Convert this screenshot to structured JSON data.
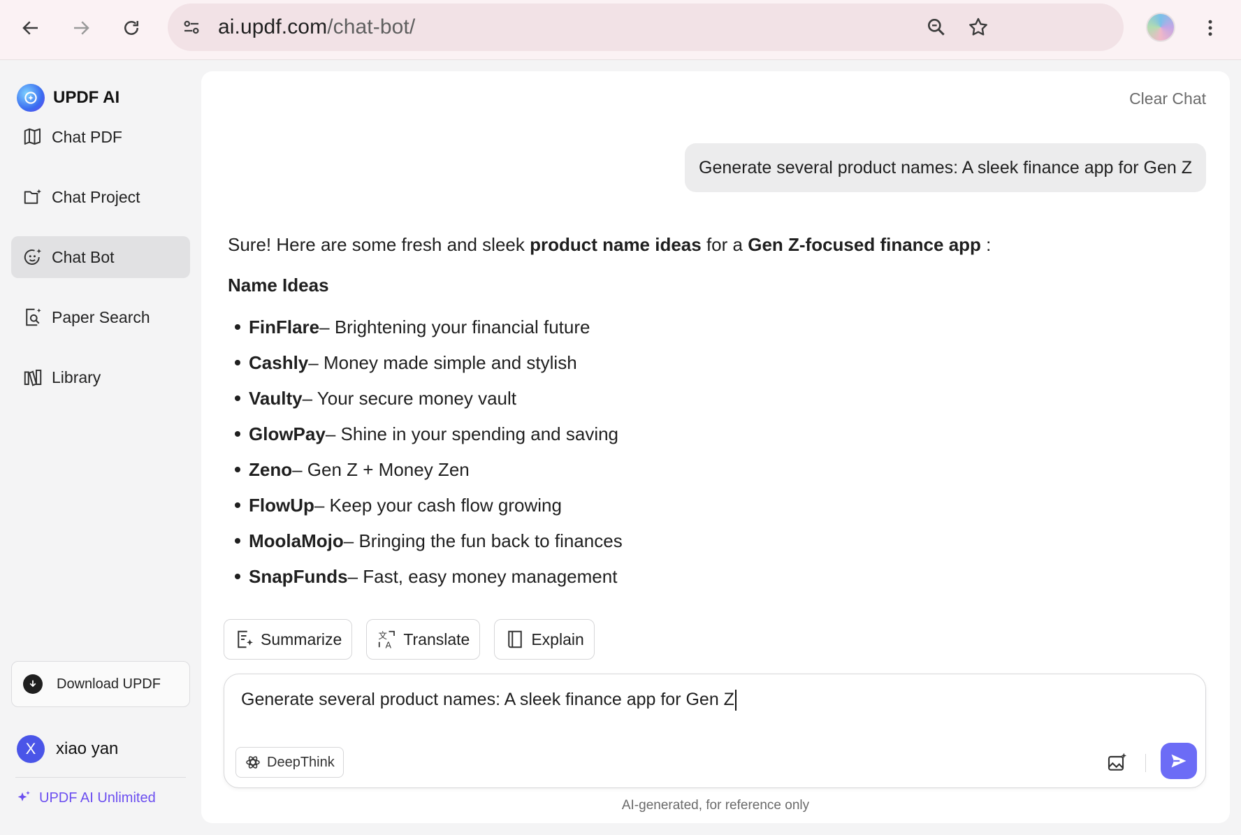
{
  "browser": {
    "url_host": "ai.updf.com",
    "url_path": "/chat-bot/"
  },
  "sidebar": {
    "brand": "UPDF AI",
    "items": [
      {
        "label": "Chat PDF",
        "icon": "map-book-icon"
      },
      {
        "label": "Chat Project",
        "icon": "folder-sparkle-icon"
      },
      {
        "label": "Chat Bot",
        "icon": "bot-face-icon",
        "active": true
      },
      {
        "label": "Paper Search",
        "icon": "document-search-icon"
      },
      {
        "label": "Library",
        "icon": "library-icon"
      }
    ],
    "download_label": "Download UPDF",
    "user": {
      "initial": "X",
      "name": "xiao yan"
    },
    "unlimited_label": "UPDF AI Unlimited"
  },
  "chat": {
    "clear_label": "Clear Chat",
    "user_message": "Generate several product names: A sleek finance app for Gen Z",
    "answer": {
      "intro_1": "Sure! Here are some fresh and sleek ",
      "intro_bold_1": "product name ideas",
      "intro_2": " for a ",
      "intro_bold_2": "Gen Z-focused finance app",
      "intro_3": " :",
      "heading": "Name Ideas",
      "ideas": [
        {
          "name": "FinFlare",
          "desc": " – Brightening your financial future"
        },
        {
          "name": "Cashly",
          "desc": " – Money made simple and stylish"
        },
        {
          "name": "Vaulty",
          "desc": " – Your secure money vault"
        },
        {
          "name": "GlowPay",
          "desc": " – Shine in your spending and saving"
        },
        {
          "name": "Zeno",
          "desc": " – Gen Z + Money Zen"
        },
        {
          "name": "FlowUp",
          "desc": " – Keep your cash flow growing"
        },
        {
          "name": "MoolaMojo",
          "desc": " – Bringing the fun back to finances"
        },
        {
          "name": "SnapFunds",
          "desc": " – Fast, easy money management"
        }
      ]
    },
    "actions": [
      "Summarize",
      "Translate",
      "Explain"
    ],
    "composer_value": "Generate several product names: A sleek finance app for Gen Z",
    "deepthink_label": "DeepThink",
    "footnote": "AI-generated, for reference only"
  },
  "colors": {
    "accent": "#6c6cf6",
    "unlimited": "#6b4ef0",
    "avatar": "#4a55e8"
  }
}
